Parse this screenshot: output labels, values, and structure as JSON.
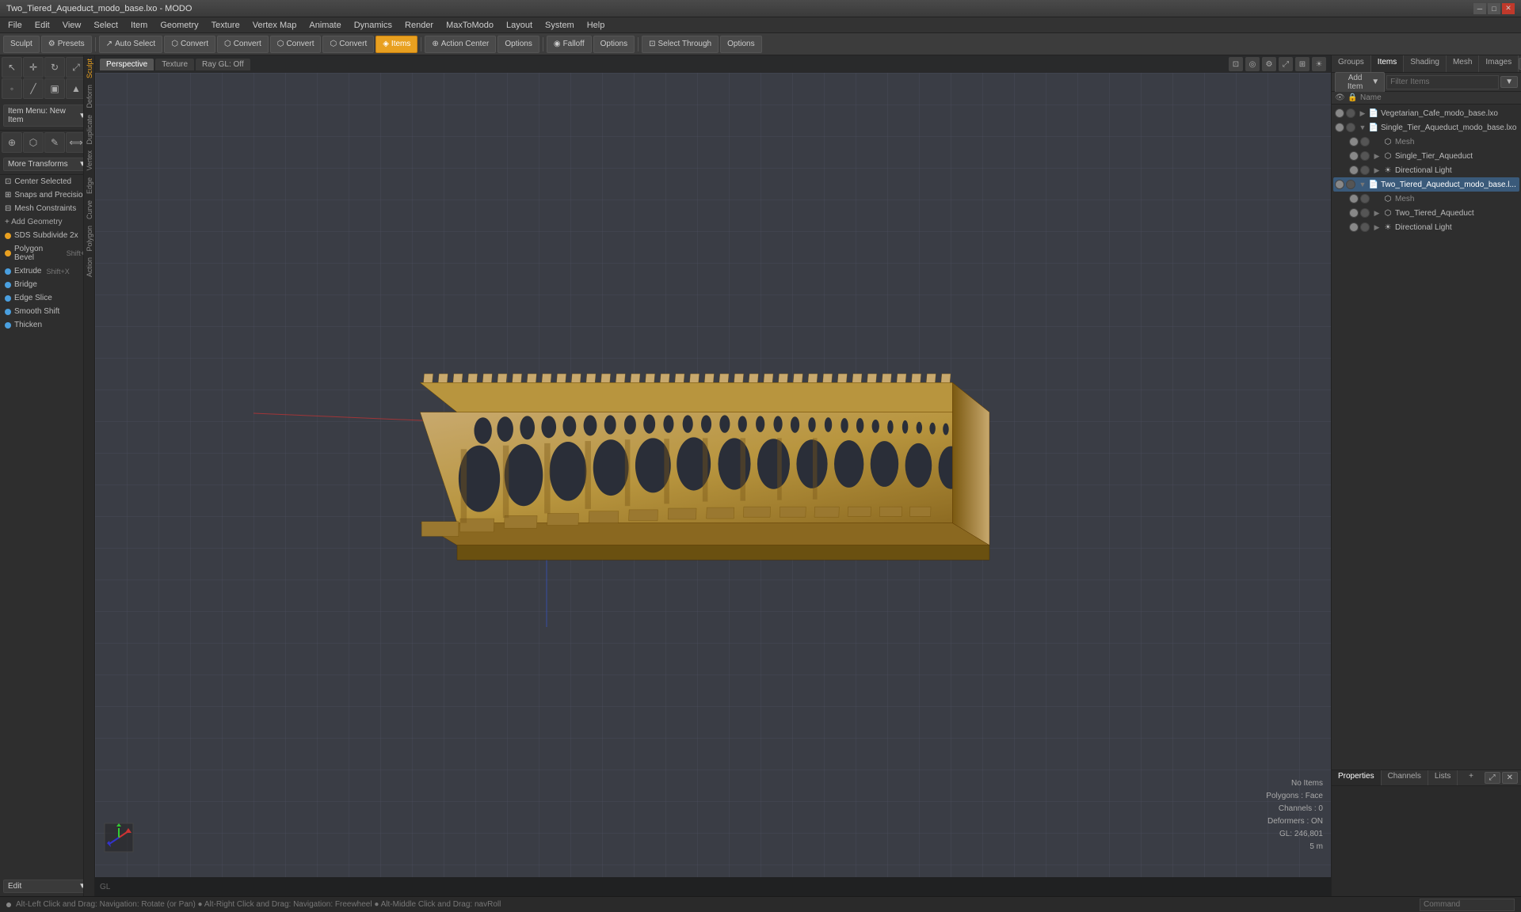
{
  "titlebar": {
    "title": "Two_Tiered_Aqueduct_modo_base.lxo - MODO",
    "controls": [
      "minimize",
      "maximize",
      "close"
    ]
  },
  "menubar": {
    "items": [
      "File",
      "Edit",
      "View",
      "Select",
      "Item",
      "Geometry",
      "Texture",
      "Vertex Map",
      "Animate",
      "Dynamics",
      "Render",
      "MaxToModo",
      "Layout",
      "System",
      "Help"
    ]
  },
  "toolbar": {
    "sculpt_label": "Sculpt",
    "presets_label": "Presets",
    "auto_select_label": "Auto Select",
    "convert1_label": "Convert",
    "convert2_label": "Convert",
    "convert3_label": "Convert",
    "convert4_label": "Convert",
    "items_label": "Items",
    "action_center_label": "Action Center",
    "options1_label": "Options",
    "falloff_label": "Falloff",
    "options2_label": "Options",
    "select_through_label": "Select Through",
    "options3_label": "Options"
  },
  "left_panel": {
    "item_menu_label": "Item Menu: New Item",
    "more_transforms_label": "More Transforms",
    "center_selected_label": "Center Selected",
    "snaps_precision_label": "Snaps and Precision",
    "mesh_constraints_label": "Mesh Constraints",
    "add_geometry_label": "+ Add Geometry",
    "sds_subdivide_label": "SDS Subdivide 2x",
    "polygon_bevel_label": "Polygon Bevel",
    "extrude_label": "Extrude",
    "bridge_label": "Bridge",
    "edge_slice_label": "Edge Slice",
    "smooth_shift_label": "Smooth Shift",
    "thicken_label": "Thicken",
    "edit_label": "Edit",
    "sidebar_tabs": [
      "Sculpt",
      "Deform",
      "Duplicate",
      "Vertex",
      "Edge",
      "Curve",
      "Polygon",
      "Action"
    ]
  },
  "viewport": {
    "tabs": [
      "Perspective",
      "Texture",
      "Ray GL: Off"
    ],
    "icon_buttons": [
      "camera",
      "render",
      "settings",
      "expand",
      "grid",
      "lighting"
    ]
  },
  "viewport_info": {
    "no_items": "No Items",
    "polygons_label": "Polygons : Face",
    "channels_label": "Channels : 0",
    "deformers_label": "Deformers : ON",
    "gl_label": "GL: 246,801",
    "scale_label": "5 m"
  },
  "statusbar": {
    "hint": "Alt-Left Click and Drag: Navigation: Rotate (or Pan) ● Alt-Right Click and Drag: Navigation: Freewheel ● Alt-Middle Click and Drag: navRoll",
    "command_placeholder": "Command"
  },
  "right_panel": {
    "tabs": [
      "Groups",
      "Items",
      "Shading",
      "Mesh",
      "Images"
    ],
    "add_item_label": "Add Item",
    "filter_placeholder": "Filter Items",
    "col_header": "Name",
    "tree": [
      {
        "id": "file1",
        "label": "Vegetarian_Cafe_modo_base.lxo",
        "indent": 0,
        "type": "file",
        "expanded": true,
        "visible": true
      },
      {
        "id": "file2",
        "label": "Single_Tier_Aqueduct_modo_base.lxo",
        "indent": 0,
        "type": "file",
        "expanded": true,
        "visible": true
      },
      {
        "id": "mesh1",
        "label": "Mesh",
        "indent": 1,
        "type": "mesh",
        "expanded": false,
        "visible": true
      },
      {
        "id": "single_tier",
        "label": "Single_Tier_Aqueduct",
        "indent": 1,
        "type": "object",
        "expanded": false,
        "visible": true
      },
      {
        "id": "dir_light1",
        "label": "Directional Light",
        "indent": 1,
        "type": "light",
        "expanded": false,
        "visible": true
      },
      {
        "id": "file3",
        "label": "Two_Tiered_Aqueduct_modo_base.l...",
        "indent": 0,
        "type": "file",
        "expanded": true,
        "visible": true,
        "selected": true
      },
      {
        "id": "mesh2",
        "label": "Mesh",
        "indent": 1,
        "type": "mesh",
        "expanded": false,
        "visible": true
      },
      {
        "id": "two_tier",
        "label": "Two_Tiered_Aqueduct",
        "indent": 1,
        "type": "object",
        "expanded": false,
        "visible": true
      },
      {
        "id": "dir_light2",
        "label": "Directional Light",
        "indent": 1,
        "type": "light",
        "expanded": false,
        "visible": true
      }
    ]
  },
  "properties_panel": {
    "tabs": [
      "Properties",
      "Channels",
      "Lists"
    ],
    "add_btn_label": "+"
  }
}
